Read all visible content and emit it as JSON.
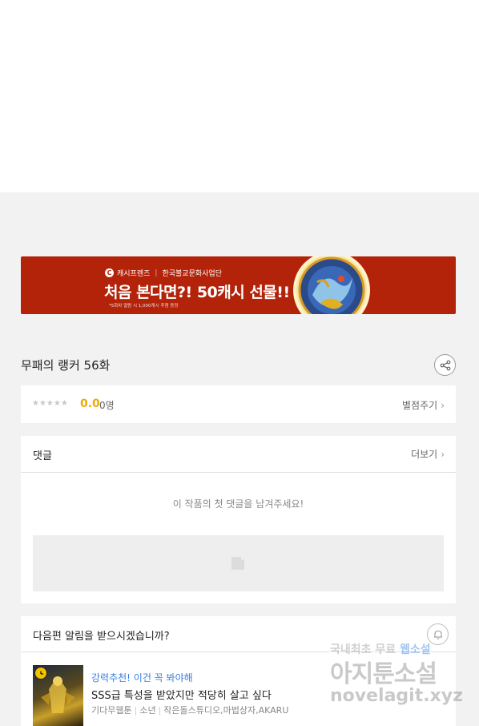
{
  "banner": {
    "brand": "캐시프렌즈",
    "partner": "한국불교문화사업단",
    "headline": "처음 본다면?! 50캐시 선물!!",
    "fine_print": "*5화차 열람 시 1,000캐시 추첨 증정"
  },
  "episode": {
    "title": "무패의 랭커 56화"
  },
  "rating": {
    "stars": "★★★★★",
    "score": "0.0",
    "votes": "0명",
    "rate_label": "별점주기",
    "chevron": "›"
  },
  "comments": {
    "title": "댓글",
    "more_label": "더보기",
    "chevron": "›",
    "empty_message": "이 작품의 첫 댓글을 남겨주세요!"
  },
  "notify": {
    "title": "다음편 알림을 받으시겠습니까?"
  },
  "recommendation": {
    "tag": "강력추천! 이건 꼭 봐야해",
    "title": "SSS급 특성을 받았지만 적당히 살고 싶다",
    "category": "기다무웹툰",
    "genre": "소년",
    "authors": "작은돌스튜디오,마법상자,AKARU"
  },
  "watermark": {
    "line1_a": "국내최초 무료",
    "line1_b": "웹소설",
    "line2": "아지툰소설",
    "line3": "novelagit.xyz"
  },
  "colors": {
    "banner_bg": "#b3230a",
    "score": "#f2a900",
    "tag_blue": "#3a7fdc"
  }
}
